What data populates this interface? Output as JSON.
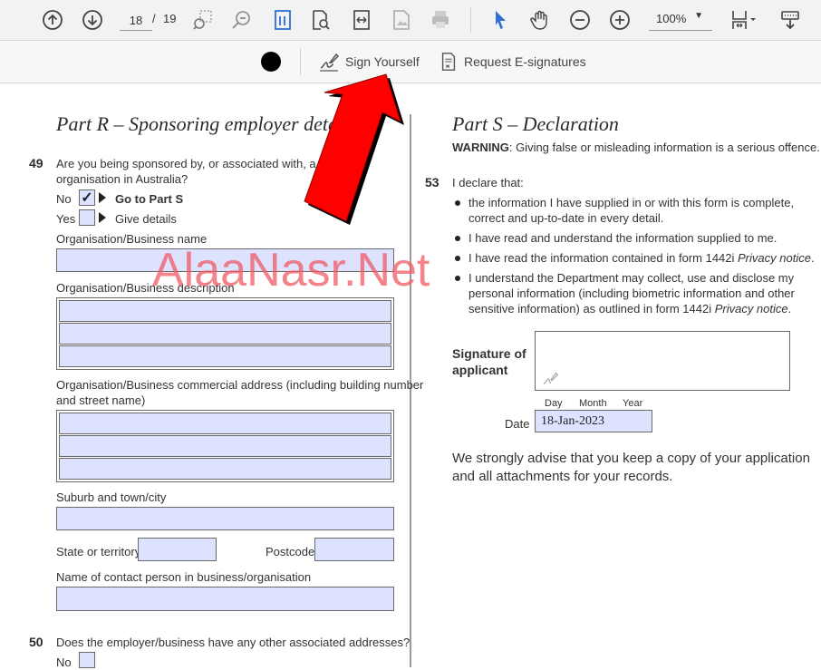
{
  "toolbar": {
    "page_current": "18",
    "page_separator": "/",
    "page_total": "19",
    "zoom": "100%",
    "icons": [
      "arrow-up-circle-icon",
      "arrow-down-circle-icon",
      "marquee-zoom-icon",
      "zoom-out-page-icon",
      "fit-page-icon",
      "search-page-icon",
      "fit-width-icon",
      "image-icon",
      "print-icon",
      "select-pointer-icon",
      "hand-icon",
      "zoom-minus-icon",
      "zoom-plus-icon",
      "page-layout-icon",
      "more-tools-icon"
    ],
    "accent_color": "#2f6fd6"
  },
  "signbar": {
    "sign_yourself": "Sign Yourself",
    "request_esign": "Request E-signatures",
    "ink_color": "#000000"
  },
  "left": {
    "title": "Part R – Sponsoring employer details",
    "q49": {
      "num": "49",
      "text1": "Are you being sponsored by, or associated with, a business",
      "text2": "organisation in Australia?",
      "no_label": "No",
      "no_checked": "✓",
      "no_goto": "Go to Part S",
      "yes_label": "Yes",
      "yes_goto": "Give details",
      "org_name": "Organisation/Business name",
      "org_desc": "Organisation/Business description",
      "org_addr1": "Organisation/Business commercial address (including building number",
      "org_addr2": "and street name)",
      "suburb": "Suburb and town/city",
      "state": "State or territory",
      "postcode": "Postcode",
      "contact": "Name of contact person in business/organisation"
    },
    "q50": {
      "num": "50",
      "text": "Does the employer/business have any other associated addresses?",
      "no_label": "No"
    }
  },
  "right": {
    "title": "Part S – Declaration",
    "warning_label": "WARNING",
    "warning_text": ": Giving false or misleading information is a serious offence.",
    "q53": {
      "num": "53",
      "intro": "I declare that:",
      "b1a": "the information I have supplied in or with this form is complete,",
      "b1b": "correct and up-to-date in every detail.",
      "b2": "I have read and understand the information supplied to me.",
      "b3a": "I have read the information contained in form 1442i ",
      "b3b": "Privacy notice",
      "b3c": ".",
      "b4a": "I understand the Department may collect, use and disclose my",
      "b4b": "personal information (including biometric information and other",
      "b4c": "sensitive information) as outlined in form 1442i ",
      "b4d": "Privacy notice",
      "b4e": "."
    },
    "signature_label1": "Signature of",
    "signature_label2": "applicant",
    "date_day": "Day",
    "date_month": "Month",
    "date_year": "Year",
    "date_label": "Date",
    "date_value": "18-Jan-2023",
    "advice1": "We strongly advise that you keep a copy of your application",
    "advice2": "and all attachments for your records."
  },
  "watermark": "AlaaNasr.Net",
  "annotation": {
    "arrow_color": "#ff0000"
  }
}
